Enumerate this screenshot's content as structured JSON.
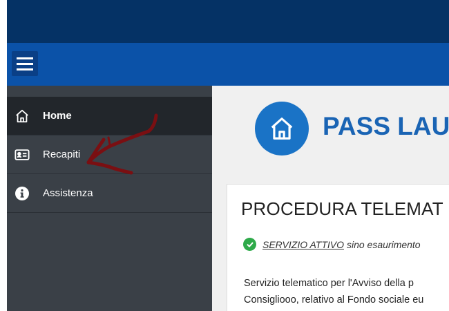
{
  "header": {
    "menu_icon": "hamburger-menu-icon"
  },
  "sidebar": {
    "items": [
      {
        "label": "Home",
        "icon": "home-icon",
        "active": true
      },
      {
        "label": "Recapiti",
        "icon": "contact-card-icon",
        "active": false
      },
      {
        "label": "Assistenza",
        "icon": "info-icon",
        "active": false
      }
    ]
  },
  "main": {
    "hero_icon": "home-icon",
    "hero_title": "PASS LAU",
    "card": {
      "title": "PROCEDURA TELEMAT",
      "status_icon": "check-circle-icon",
      "status_active": "SERVIZIO ATTIVO",
      "status_rest": "sino esaurimento",
      "desc_line1": "Servizio telematico per l'Avviso della p",
      "desc_line2": "Consigliooo, relativo al Fondo sociale eu"
    }
  },
  "colors": {
    "topbar": "#053265",
    "navbar": "#0b52a8",
    "sidebar": "#3a4047",
    "sidebar_active": "#22262b",
    "accent": "#1a73c6",
    "title_blue": "#1a64b4",
    "success": "#2eaa4a",
    "annotation": "#7a0f12"
  }
}
